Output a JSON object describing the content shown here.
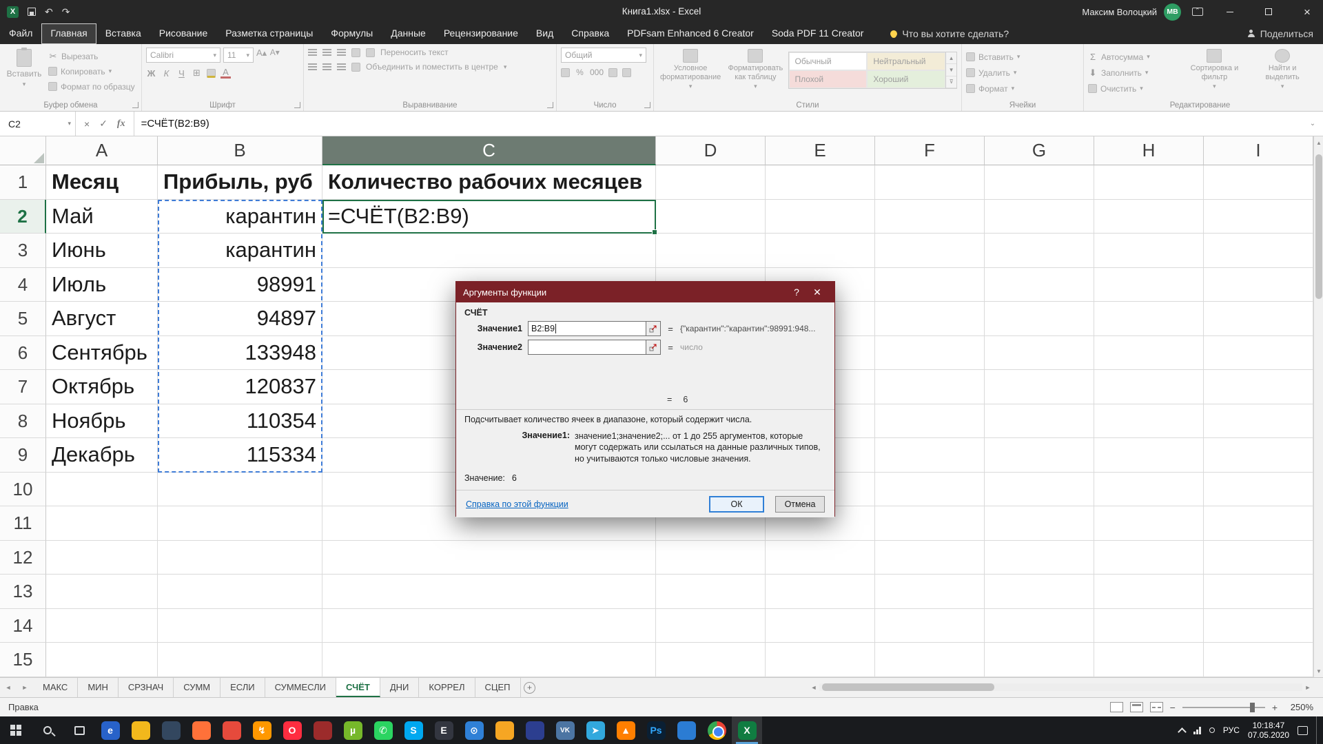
{
  "window": {
    "title": "Книга1.xlsx  -  Excel",
    "user_name": "Максим Волоцкий",
    "user_initials": "МВ"
  },
  "tellme": "Что вы хотите сделать?",
  "share": "Поделиться",
  "ribbon_tabs": [
    {
      "label": "Файл",
      "active": false
    },
    {
      "label": "Главная",
      "active": true
    },
    {
      "label": "Вставка",
      "active": false
    },
    {
      "label": "Рисование",
      "active": false
    },
    {
      "label": "Разметка страницы",
      "active": false
    },
    {
      "label": "Формулы",
      "active": false
    },
    {
      "label": "Данные",
      "active": false
    },
    {
      "label": "Рецензирование",
      "active": false
    },
    {
      "label": "Вид",
      "active": false
    },
    {
      "label": "Справка",
      "active": false
    },
    {
      "label": "PDFsam Enhanced 6 Creator",
      "active": false
    },
    {
      "label": "Soda PDF 11 Creator",
      "active": false
    }
  ],
  "ribbon": {
    "clipboard": {
      "label": "Буфер обмена",
      "paste": "Вставить",
      "cut": "Вырезать",
      "copy": "Копировать",
      "format_painter": "Формат по образцу"
    },
    "font": {
      "label": "Шрифт",
      "font_name": "Calibri",
      "font_size": "11",
      "bold": "Ж",
      "italic": "К",
      "underline": "Ч"
    },
    "alignment": {
      "label": "Выравнивание",
      "wrap": "Переносить текст",
      "merge": "Объединить и поместить в центре"
    },
    "number": {
      "label": "Число",
      "format": "Общий",
      "percent": "%",
      "thousands": "000"
    },
    "styles": {
      "label": "Стили",
      "conditional": "Условное форматирование",
      "format_table": "Форматировать как таблицу",
      "gallery": [
        "Обычный",
        "Нейтральный",
        "Плохой",
        "Хороший"
      ]
    },
    "cells": {
      "label": "Ячейки",
      "insert": "Вставить",
      "delete": "Удалить",
      "format": "Формат"
    },
    "editing": {
      "label": "Редактирование",
      "autosum": "Автосумма",
      "fill": "Заполнить",
      "clear": "Очистить",
      "sort": "Сортировка и фильтр",
      "find": "Найти и выделить"
    }
  },
  "formula_bar": {
    "cell_ref": "C2",
    "formula": "=СЧЁТ(B2:B9)"
  },
  "grid": {
    "columns": [
      "A",
      "B",
      "C",
      "D",
      "E",
      "F",
      "G",
      "H",
      "I"
    ],
    "selected_column": "C",
    "selected_row": 2,
    "row_count": 15,
    "rows": [
      {
        "A": "Месяц",
        "B": "Прибыль, руб",
        "C": "Количество рабочих месяцев"
      },
      {
        "A": "Май",
        "B": "карантин",
        "C": "=СЧЁТ(B2:B9)"
      },
      {
        "A": "Июнь",
        "B": "карантин"
      },
      {
        "A": "Июль",
        "B": "98991"
      },
      {
        "A": "Август",
        "B": "94897"
      },
      {
        "A": "Сентябрь",
        "B": "133948"
      },
      {
        "A": "Октябрь",
        "B": "120837"
      },
      {
        "A": "Ноябрь",
        "B": "110354"
      },
      {
        "A": "Декабрь",
        "B": "115334"
      }
    ]
  },
  "dialog": {
    "title": "Аргументы функции",
    "help_btn": "?",
    "close_btn": "✕",
    "function_name": "СЧЁТ",
    "eq": "=",
    "arg1_label": "Значение1",
    "arg1_value": "B2:B9",
    "arg1_result": "{\"карантин\":\"карантин\":98991:948...",
    "arg2_label": "Значение2",
    "arg2_result": "число",
    "result_value": "6",
    "description": "Подсчитывает количество ячеек в диапазоне, который содержит числа.",
    "help_arg_label": "Значение1:",
    "help_arg_text": "значение1;значение2;... от 1 до 255 аргументов, которые могут содержать или ссылаться на данные различных типов, но учитываются только числовые значения.",
    "value_label": "Значение:",
    "value": "6",
    "help_link": "Справка по этой функции",
    "ok": "ОК",
    "cancel": "Отмена"
  },
  "sheet_tabs": {
    "items": [
      "МАКС",
      "МИН",
      "СРЗНАЧ",
      "СУММ",
      "ЕСЛИ",
      "СУММЕСЛИ",
      "СЧЁТ",
      "ДНИ",
      "КОРРЕЛ",
      "СЦЕП"
    ],
    "active": "СЧЁТ"
  },
  "status": {
    "mode": "Правка",
    "zoom": "250%"
  },
  "taskbar": {
    "apps": [
      {
        "name": "edge-browser",
        "color": "#2862c9",
        "glyph": "e"
      },
      {
        "name": "file-explorer",
        "color": "#f2b81c",
        "glyph": ""
      },
      {
        "name": "app-indigo",
        "color": "#33475f",
        "glyph": ""
      },
      {
        "name": "firefox",
        "color": "#ff7139",
        "glyph": ""
      },
      {
        "name": "app-red",
        "color": "#e64a3c",
        "glyph": ""
      },
      {
        "name": "download-manager",
        "color": "#ff9800",
        "glyph": "↯"
      },
      {
        "name": "opera",
        "color": "#ff2d40",
        "glyph": "O"
      },
      {
        "name": "app-darkred",
        "color": "#9c2b2b",
        "glyph": ""
      },
      {
        "name": "utorrent",
        "color": "#76b82a",
        "glyph": "µ"
      },
      {
        "name": "whatsapp",
        "color": "#2bd461",
        "glyph": "✆"
      },
      {
        "name": "skype",
        "color": "#00a8f0",
        "glyph": "S"
      },
      {
        "name": "epic-games",
        "color": "#333640",
        "glyph": "E"
      },
      {
        "name": "compass-browser",
        "color": "#2f80d6",
        "glyph": "⊙"
      },
      {
        "name": "app-amber",
        "color": "#f6a623",
        "glyph": ""
      },
      {
        "name": "app-navy",
        "color": "#2c3e8f",
        "glyph": ""
      },
      {
        "name": "vk",
        "color": "#4c75a3",
        "glyph": "VK"
      },
      {
        "name": "telegram",
        "color": "#32a8dd",
        "glyph": "➤"
      },
      {
        "name": "vlc",
        "color": "#ff7f00",
        "glyph": "▲"
      },
      {
        "name": "photoshop",
        "color": "#0a1f33",
        "glyph": "Ps"
      },
      {
        "name": "app-blue",
        "color": "#2b7cd3",
        "glyph": ""
      },
      {
        "name": "chrome",
        "color": "",
        "glyph": ""
      },
      {
        "name": "excel",
        "color": "#107c41",
        "glyph": "X"
      }
    ],
    "tray": {
      "lang": "РУС",
      "time": "10:18:47",
      "date": "07.05.2020"
    }
  }
}
